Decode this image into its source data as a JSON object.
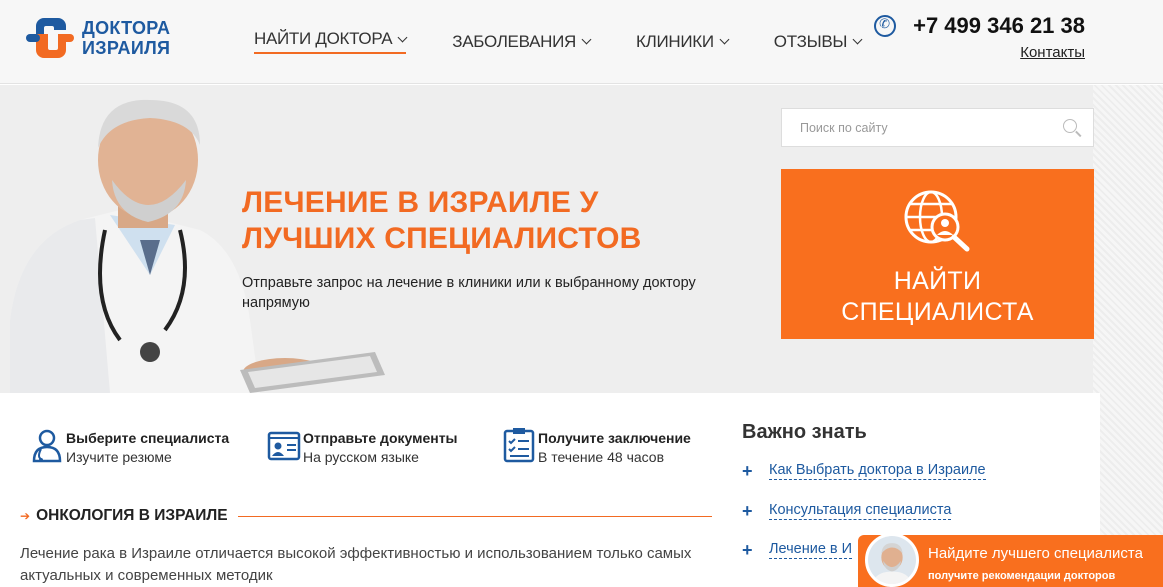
{
  "header": {
    "logo_line1": "ДОКТОРА",
    "logo_line2": "ИЗРАИЛЯ",
    "nav": [
      {
        "label": "НАЙТИ ДОКТОРА",
        "active": true
      },
      {
        "label": "ЗАБОЛЕВАНИЯ",
        "active": false
      },
      {
        "label": "КЛИНИКИ",
        "active": false
      },
      {
        "label": "ОТЗЫВЫ",
        "active": false
      }
    ],
    "phone": "+7 499 346 21 38",
    "contacts_label": "Контакты"
  },
  "hero": {
    "title_line1": "ЛЕЧЕНИЕ В ИЗРАИЛЕ У",
    "title_line2": "ЛУЧШИХ СПЕЦИАЛИСТОВ",
    "text": "Отправьте запрос на лечение в клиники или к выбранному доктору напрямую",
    "search_placeholder": "Поиск по сайту",
    "find_line1": "НАЙТИ",
    "find_line2": "СПЕЦИАЛИСТА"
  },
  "steps": [
    {
      "title": "Выберите специалиста",
      "sub": "Изучите резюме",
      "icon": "doctor-icon"
    },
    {
      "title": "Отправьте документы",
      "sub": "На русском языке",
      "icon": "id-card-icon"
    },
    {
      "title": "Получите заключение",
      "sub": "В течение 48 часов",
      "icon": "checklist-icon"
    }
  ],
  "section": {
    "title": "ОНКОЛОГИЯ В ИЗРАИЛЕ",
    "text": "Лечение рака в Израиле отличается высокой эффективностью и использованием только самых актуальных и современных методик"
  },
  "important": {
    "title": "Важно знать",
    "links": [
      "Как Выбрать доктора в Израиле",
      "Консультация специалиста",
      "Лечение в И"
    ]
  },
  "widget": {
    "title": "Найдите лучшего специалиста",
    "sub": "получите рекомендации докторов"
  },
  "colors": {
    "accent": "#f96f1e",
    "brand_blue": "#1e5aa0",
    "hero_bg": "#eeeeee"
  }
}
